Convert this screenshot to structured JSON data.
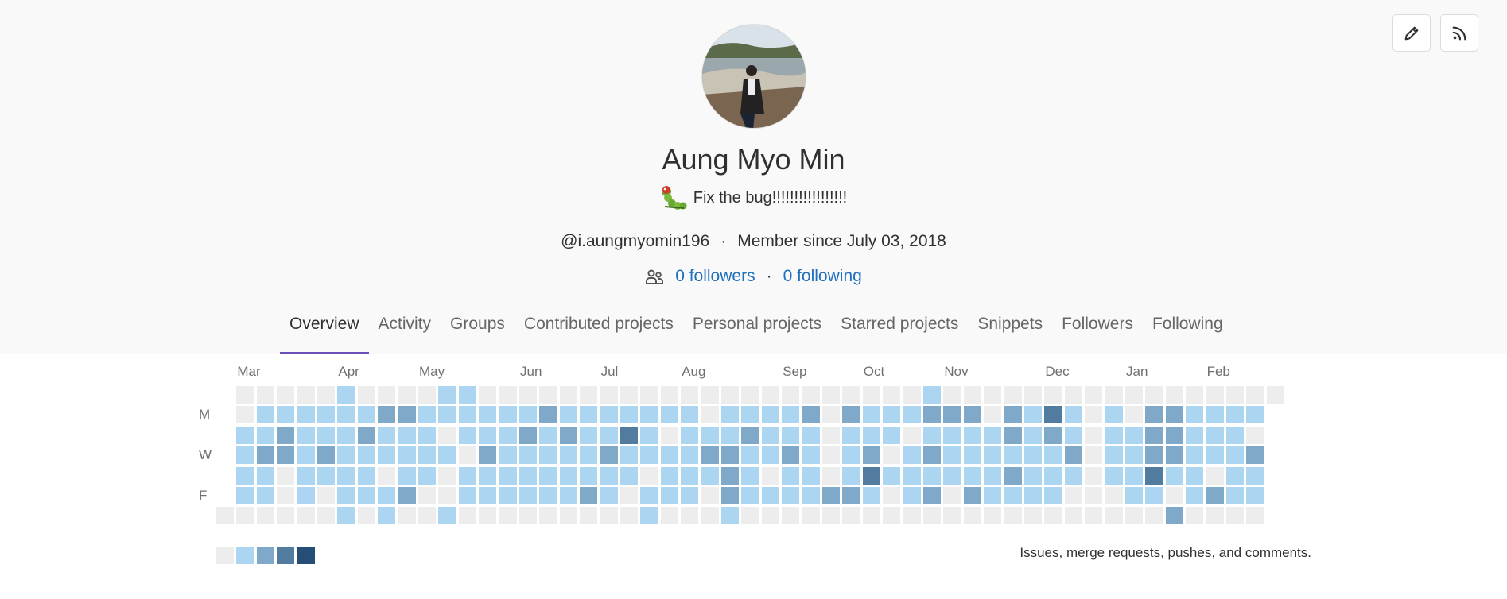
{
  "header": {
    "edit_icon": "pencil-icon",
    "rss_icon": "rss-icon"
  },
  "profile": {
    "name": "Aung Myo Min",
    "status_emoji": "caterpillar-emoji",
    "status_text": "Fix the bug!!!!!!!!!!!!!!!!!",
    "username": "@i.aungmyomin196",
    "separator": "·",
    "member_since": "Member since July 03, 2018",
    "followers_icon": "users-icon",
    "followers": "0 followers",
    "following": "0 following"
  },
  "tabs": [
    {
      "label": "Overview",
      "active": true
    },
    {
      "label": "Activity"
    },
    {
      "label": "Groups"
    },
    {
      "label": "Contributed projects"
    },
    {
      "label": "Personal projects"
    },
    {
      "label": "Starred projects"
    },
    {
      "label": "Snippets"
    },
    {
      "label": "Followers"
    },
    {
      "label": "Following"
    }
  ],
  "calendar": {
    "months": [
      {
        "label": "Mar",
        "week": 1
      },
      {
        "label": "Apr",
        "week": 6
      },
      {
        "label": "May",
        "week": 10
      },
      {
        "label": "Jun",
        "week": 15
      },
      {
        "label": "Jul",
        "week": 19
      },
      {
        "label": "Aug",
        "week": 23
      },
      {
        "label": "Sep",
        "week": 28
      },
      {
        "label": "Oct",
        "week": 32
      },
      {
        "label": "Nov",
        "week": 36
      },
      {
        "label": "Dec",
        "week": 41
      },
      {
        "label": "Jan",
        "week": 45
      },
      {
        "label": "Feb",
        "week": 49
      }
    ],
    "day_labels": [
      {
        "label": "M",
        "row": 1
      },
      {
        "label": "W",
        "row": 3
      },
      {
        "label": "F",
        "row": 5
      }
    ],
    "colors": [
      "#ededed",
      "#acd5f2",
      "#7fa8c9",
      "#527ba0",
      "#254e77"
    ],
    "contribution_levels": [
      [
        -1,
        -1,
        -1,
        -1,
        -1,
        -1,
        0
      ],
      [
        0,
        0,
        1,
        1,
        1,
        1,
        0
      ],
      [
        0,
        1,
        1,
        2,
        1,
        1,
        0
      ],
      [
        0,
        1,
        2,
        2,
        0,
        0,
        0
      ],
      [
        0,
        1,
        1,
        1,
        1,
        1,
        0
      ],
      [
        0,
        1,
        1,
        2,
        1,
        0,
        0
      ],
      [
        1,
        1,
        1,
        1,
        1,
        1,
        1
      ],
      [
        0,
        1,
        2,
        1,
        1,
        1,
        0
      ],
      [
        0,
        2,
        1,
        1,
        0,
        1,
        1
      ],
      [
        0,
        2,
        1,
        1,
        1,
        2,
        0
      ],
      [
        0,
        1,
        1,
        1,
        1,
        0,
        0
      ],
      [
        1,
        1,
        0,
        1,
        0,
        0,
        1
      ],
      [
        1,
        1,
        1,
        0,
        1,
        1,
        0
      ],
      [
        0,
        1,
        1,
        2,
        1,
        1,
        0
      ],
      [
        0,
        1,
        1,
        1,
        1,
        1,
        0
      ],
      [
        0,
        1,
        2,
        1,
        1,
        1,
        0
      ],
      [
        0,
        2,
        1,
        1,
        1,
        1,
        0
      ],
      [
        0,
        1,
        2,
        1,
        1,
        1,
        0
      ],
      [
        0,
        1,
        1,
        1,
        1,
        2,
        0
      ],
      [
        0,
        1,
        1,
        2,
        1,
        1,
        0
      ],
      [
        0,
        1,
        3,
        1,
        1,
        0,
        0
      ],
      [
        0,
        1,
        1,
        1,
        0,
        1,
        1
      ],
      [
        0,
        1,
        0,
        1,
        1,
        1,
        0
      ],
      [
        0,
        1,
        1,
        1,
        1,
        1,
        0
      ],
      [
        0,
        0,
        1,
        2,
        1,
        0,
        0
      ],
      [
        0,
        1,
        1,
        2,
        2,
        2,
        1
      ],
      [
        0,
        1,
        2,
        1,
        1,
        1,
        0
      ],
      [
        0,
        1,
        1,
        1,
        0,
        1,
        0
      ],
      [
        0,
        1,
        1,
        2,
        1,
        1,
        0
      ],
      [
        0,
        2,
        1,
        1,
        1,
        1,
        0
      ],
      [
        0,
        0,
        0,
        0,
        0,
        2,
        0
      ],
      [
        0,
        2,
        1,
        1,
        1,
        2,
        0
      ],
      [
        0,
        1,
        1,
        2,
        3,
        1,
        0
      ],
      [
        0,
        1,
        1,
        0,
        1,
        0,
        0
      ],
      [
        0,
        1,
        0,
        1,
        1,
        1,
        0
      ],
      [
        1,
        2,
        1,
        2,
        1,
        2,
        0
      ],
      [
        0,
        2,
        1,
        1,
        1,
        0,
        0
      ],
      [
        0,
        2,
        1,
        1,
        1,
        2,
        0
      ],
      [
        0,
        0,
        1,
        1,
        1,
        1,
        0
      ],
      [
        0,
        2,
        2,
        1,
        2,
        1,
        0
      ],
      [
        0,
        1,
        1,
        1,
        1,
        1,
        0
      ],
      [
        0,
        3,
        2,
        1,
        1,
        1,
        0
      ],
      [
        0,
        1,
        1,
        2,
        1,
        0,
        0
      ],
      [
        0,
        0,
        0,
        0,
        0,
        0,
        0
      ],
      [
        0,
        1,
        1,
        1,
        1,
        0,
        0
      ],
      [
        0,
        0,
        1,
        1,
        1,
        1,
        0
      ],
      [
        0,
        2,
        2,
        2,
        3,
        1,
        0
      ],
      [
        0,
        2,
        2,
        2,
        1,
        0,
        2
      ],
      [
        0,
        1,
        1,
        1,
        1,
        1,
        0
      ],
      [
        0,
        1,
        1,
        1,
        0,
        2,
        0
      ],
      [
        0,
        1,
        1,
        1,
        1,
        1,
        0
      ],
      [
        0,
        1,
        0,
        2,
        1,
        1,
        0
      ],
      [
        0,
        -1,
        -1,
        -1,
        -1,
        -1,
        -1
      ]
    ],
    "legend_levels": [
      0,
      1,
      2,
      3,
      4
    ],
    "caption": "Issues, merge requests, pushes, and comments."
  }
}
